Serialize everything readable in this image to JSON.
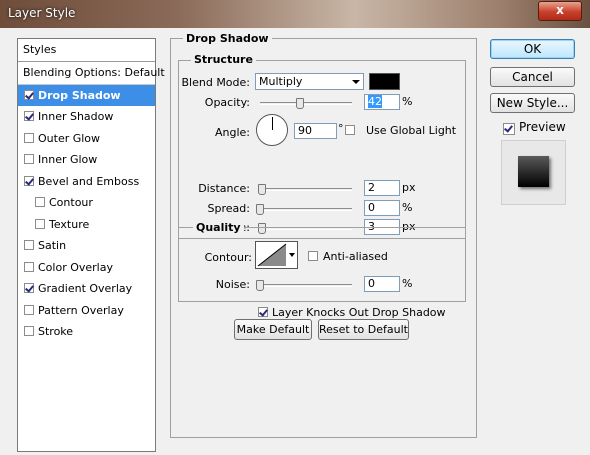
{
  "window": {
    "title": "Layer Style",
    "close_glyph": "x"
  },
  "styles_panel": {
    "header": "Styles",
    "blending_options": "Blending Options: Default",
    "items": [
      {
        "label": "Drop Shadow",
        "checked": true,
        "selected": true,
        "indent": false
      },
      {
        "label": "Inner Shadow",
        "checked": true,
        "selected": false,
        "indent": false
      },
      {
        "label": "Outer Glow",
        "checked": false,
        "selected": false,
        "indent": false
      },
      {
        "label": "Inner Glow",
        "checked": false,
        "selected": false,
        "indent": false
      },
      {
        "label": "Bevel and Emboss",
        "checked": true,
        "selected": false,
        "indent": false
      },
      {
        "label": "Contour",
        "checked": false,
        "selected": false,
        "indent": true
      },
      {
        "label": "Texture",
        "checked": false,
        "selected": false,
        "indent": true
      },
      {
        "label": "Satin",
        "checked": false,
        "selected": false,
        "indent": false
      },
      {
        "label": "Color Overlay",
        "checked": false,
        "selected": false,
        "indent": false
      },
      {
        "label": "Gradient Overlay",
        "checked": true,
        "selected": false,
        "indent": false
      },
      {
        "label": "Pattern Overlay",
        "checked": false,
        "selected": false,
        "indent": false
      },
      {
        "label": "Stroke",
        "checked": false,
        "selected": false,
        "indent": false
      }
    ]
  },
  "drop_shadow": {
    "group_title": "Drop Shadow",
    "structure": {
      "title": "Structure",
      "blend_mode_label": "Blend Mode:",
      "blend_mode_value": "Multiply",
      "shadow_color": "#000000",
      "opacity_label": "Opacity:",
      "opacity_value": "42",
      "opacity_unit": "%",
      "opacity_level": 0.42,
      "angle_label": "Angle:",
      "angle_value": "90",
      "angle_unit": "°",
      "use_global_light_label": "Use Global Light",
      "use_global_light_checked": false,
      "distance_label": "Distance:",
      "distance_value": "2",
      "distance_unit": "px",
      "spread_label": "Spread:",
      "spread_value": "0",
      "spread_unit": "%",
      "size_label": "Size:",
      "size_value": "3",
      "size_unit": "px"
    },
    "quality": {
      "title": "Quality",
      "contour_label": "Contour:",
      "anti_aliased_label": "Anti-aliased",
      "anti_aliased_checked": false,
      "noise_label": "Noise:",
      "noise_value": "0",
      "noise_unit": "%"
    },
    "knockout_label": "Layer Knocks Out Drop Shadow",
    "knockout_checked": true,
    "make_default_label": "Make Default",
    "reset_default_label": "Reset to Default"
  },
  "actions": {
    "ok_label": "OK",
    "cancel_label": "Cancel",
    "new_style_label": "New Style...",
    "preview_label": "Preview",
    "preview_checked": true
  }
}
